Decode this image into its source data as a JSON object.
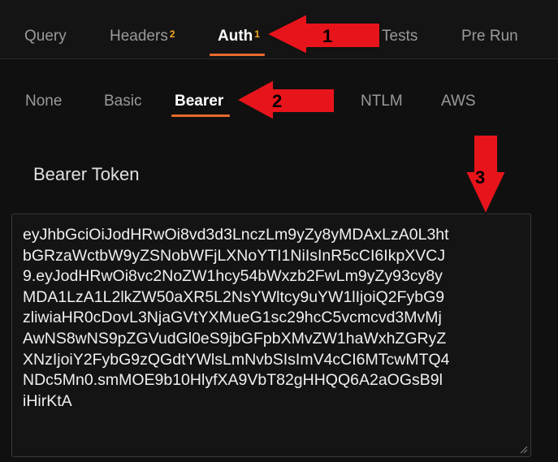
{
  "tabs": [
    {
      "label": "Query",
      "badge": ""
    },
    {
      "label": "Headers",
      "badge": "2"
    },
    {
      "label": "Auth",
      "badge": "1"
    },
    {
      "label": "Tests",
      "badge": ""
    },
    {
      "label": "Pre Run",
      "badge": ""
    }
  ],
  "auth_types": [
    "None",
    "Basic",
    "Bearer",
    "NTLM",
    "AWS"
  ],
  "bearer": {
    "label": "Bearer Token",
    "token_lines": [
      "eyJhbGciOiJodHRwOi8vd3d3LnczLm9yZy8yMDAxLzA0L3ht",
      "bGRzaWctbW9yZSNobWFjLXNoYTI1NiIsInR5cCI6IkpXVCJ",
      "9.eyJodHRwOi8vc2NoZW1hcy54bWxzb2FwLm9yZy93cy8y",
      "MDA1LzA1L2lkZW50aXR5L2NsYWltcy9uYW1lIjoiQ2FybG9",
      "zliwiaHR0cDovL3NjaGVtYXMueG1sc29hcC5vcmcvd3MvMj",
      "AwNS8wNS9pZGVudGl0eS9jbGFpbXMvZW1haWxhZGRyZ",
      "XNzIjoiY2FybG9zQGdtYWlsLmNvbSIsImV4cCI6MTcwMTQ4",
      "NDc5Mn0.smMOE9b10HlyfXA9VbT82gHHQQ6A2aOGsB9l",
      "iHirKtA"
    ]
  },
  "annotations": [
    "1",
    "2",
    "3"
  ],
  "colors": {
    "accent": "#e86a2c",
    "badge": "#f5a623",
    "arrow": "#e8141b"
  }
}
